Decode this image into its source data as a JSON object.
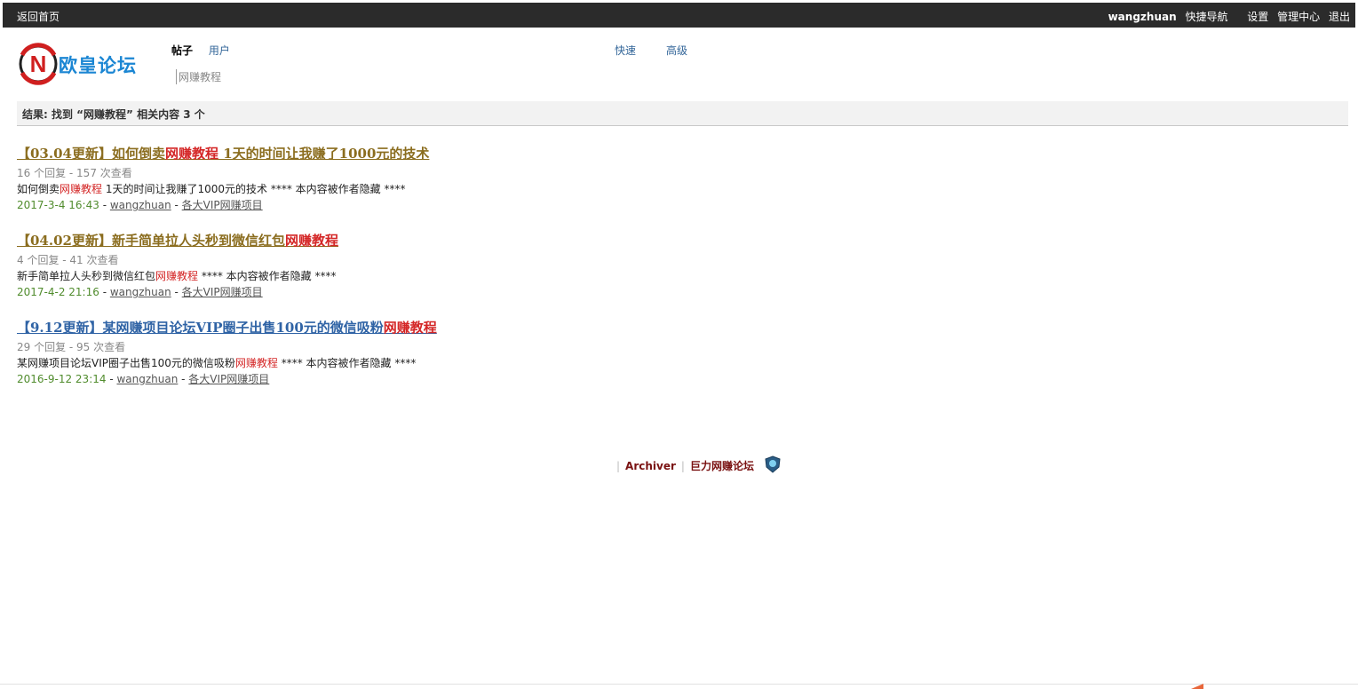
{
  "topbar": {
    "home": "返回首页",
    "username": "wangzhuan",
    "quick_nav": "快捷导航",
    "settings": "设置",
    "admin": "管理中心",
    "logout": "退出"
  },
  "logo": {
    "text": "欧皇论坛",
    "mark": "N"
  },
  "search": {
    "tab_posts": "帖子",
    "tab_users": "用户",
    "keyword": "网赚教程",
    "fast": "快速",
    "advanced": "高级"
  },
  "result_summary": "结果: 找到 “网赚教程” 相关内容 3 个",
  "results": [
    {
      "title_pre": "【03.04更新】如何倒卖",
      "title_hl": "网赚教程",
      "title_post": " 1天的时间让我赚了1000元的技术",
      "title_color": "#8b6d1f",
      "stats": "16 个回复 - 157 次查看",
      "excerpt_pre": "如何倒卖",
      "excerpt_hl": "网赚教程",
      "excerpt_post": " 1天的时间让我赚了1000元的技术 **** 本内容被作者隐藏 ****",
      "date": "2017-3-4 16:43",
      "author": "wangzhuan",
      "forum": "各大VIP网赚项目"
    },
    {
      "title_pre": "【04.02更新】新手简单拉人头秒到微信红包",
      "title_hl": "网赚教程",
      "title_post": "",
      "title_color": "#8b6d1f",
      "stats": "4 个回复 - 41 次查看",
      "excerpt_pre": "新手简单拉人头秒到微信红包",
      "excerpt_hl": "网赚教程",
      "excerpt_post": " **** 本内容被作者隐藏 ****",
      "date": "2017-4-2 21:16",
      "author": "wangzhuan",
      "forum": "各大VIP网赚项目"
    },
    {
      "title_pre": "【9.12更新】某网赚项目论坛VIP圈子出售100元的微信吸粉",
      "title_hl": "网赚教程",
      "title_post": "",
      "title_color": "#2f63a5",
      "stats": "29 个回复 - 95 次查看",
      "excerpt_pre": "某网赚项目论坛VIP圈子出售100元的微信吸粉",
      "excerpt_hl": "网赚教程",
      "excerpt_post": " **** 本内容被作者隐藏 ****",
      "date": "2016-9-12 23:14",
      "author": "wangzhuan",
      "forum": "各大VIP网赚项目"
    }
  ],
  "footer": {
    "archiver": "Archiver",
    "site": "巨力网赚论坛",
    "badge_icon": "shield-icon"
  },
  "colors": {
    "topbar_bg": "#2b2b2b",
    "highlight": "#d42626",
    "date": "#508c2d",
    "link": "#336699"
  }
}
